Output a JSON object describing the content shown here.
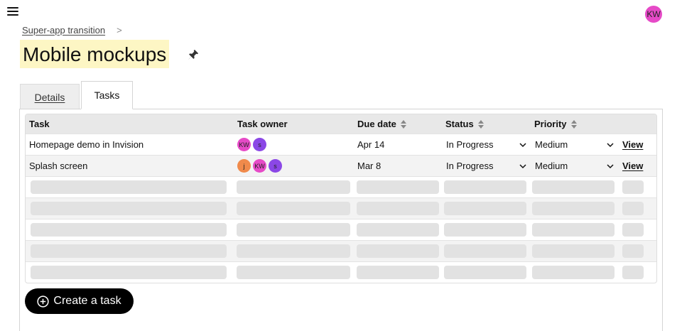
{
  "header": {
    "user_initials": "KW",
    "user_color": "#e64ac7"
  },
  "breadcrumb": {
    "parent": "Super-app transition",
    "separator": ">"
  },
  "page": {
    "title": "Mobile mockups"
  },
  "tabs": [
    {
      "label": "Details",
      "active": false
    },
    {
      "label": "Tasks",
      "active": true
    }
  ],
  "table": {
    "columns": [
      "Task",
      "Task owner",
      "Due date",
      "Status",
      "Priority"
    ],
    "rows": [
      {
        "task": "Homepage demo in Invision",
        "owners": [
          {
            "initials": "KW",
            "color": "#e64ac7"
          },
          {
            "initials": "s",
            "color": "#8b47e6"
          }
        ],
        "due": "Apr 14",
        "status": "In Progress",
        "priority": "Medium",
        "action": "View"
      },
      {
        "task": "Splash screen",
        "owners": [
          {
            "initials": "j",
            "color": "#f08a4b"
          },
          {
            "initials": "KW",
            "color": "#e64ac7"
          },
          {
            "initials": "s",
            "color": "#8b47e6"
          }
        ],
        "due": "Mar 8",
        "status": "In Progress",
        "priority": "Medium",
        "action": "View"
      }
    ],
    "placeholder_rows": 5
  },
  "actions": {
    "create_task": "Create a task"
  }
}
